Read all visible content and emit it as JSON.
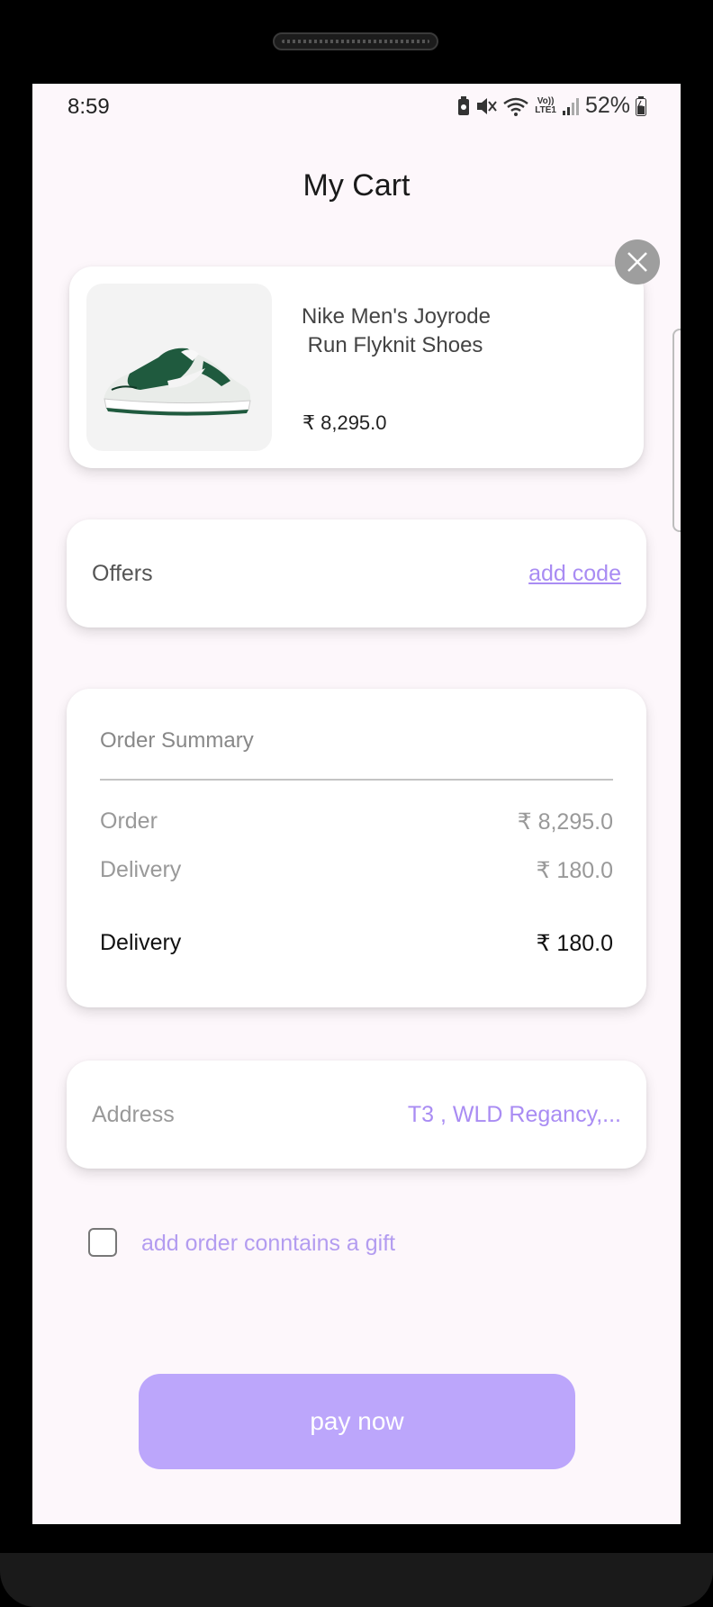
{
  "status_bar": {
    "time": "8:59",
    "battery_percent": "52%",
    "lte_top": "Vo))",
    "lte_bottom": "LTE1",
    "icons": [
      "sim-status-icon",
      "mute-icon",
      "wifi-icon",
      "volte-icon",
      "signal-icon",
      "battery-icon"
    ]
  },
  "page": {
    "title": "My Cart"
  },
  "cart_item": {
    "name": "Nike Men's Joyrode\n Run Flyknit Shoes",
    "price": "₹ 8,295.0",
    "image": "green-white-sneaker",
    "remove_icon": "close-icon"
  },
  "offers": {
    "label": "Offers",
    "link": "add code"
  },
  "order_summary": {
    "title": "Order Summary",
    "rows": [
      {
        "label": "Order",
        "value": "₹ 8,295.0"
      },
      {
        "label": "Delivery",
        "value": "₹ 180.0"
      }
    ],
    "total": {
      "label": "Delivery",
      "value": "₹ 180.0"
    }
  },
  "address": {
    "label": "Address",
    "value": "T3 , WLD Regancy,..."
  },
  "gift": {
    "label": "add order conntains a gift",
    "checked": false
  },
  "pay_button": {
    "label": "pay now"
  },
  "colors": {
    "accent": "#a98cf3",
    "button": "#bca6fb",
    "screen_bg": "#fdf7fb"
  }
}
